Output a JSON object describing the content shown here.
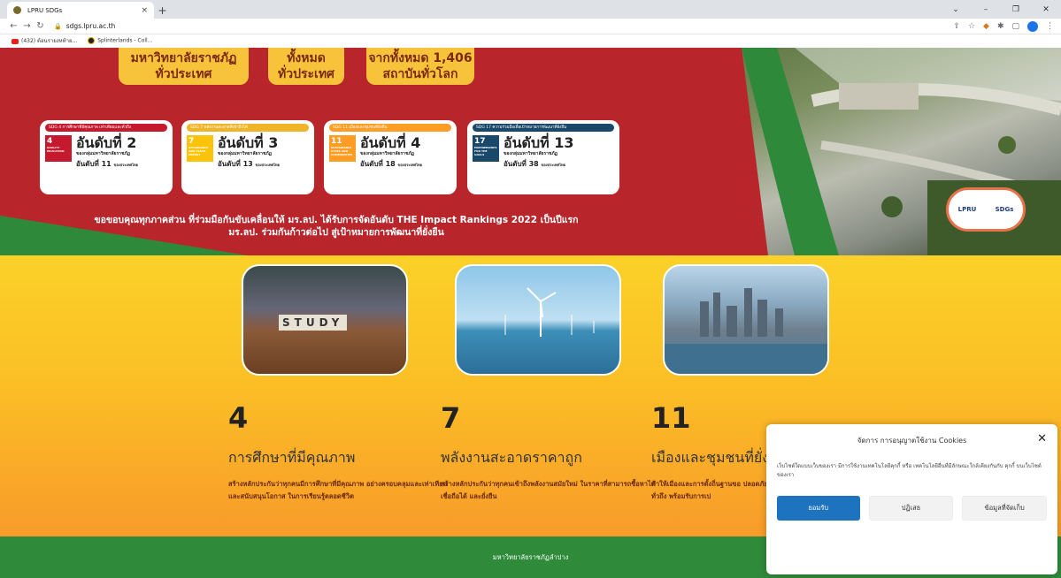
{
  "browser": {
    "tab_title": "LPRU SDGs",
    "tab_close": "×",
    "new_tab": "+",
    "url": "sdgs.lpru.ac.th",
    "bookmarks": [
      "(432) ต้อนรายงหท้าย...",
      "Splinterlands - Coll..."
    ]
  },
  "hero": {
    "top_boxes": [
      {
        "l1": "มหาวิทยาลัยราชภัฏ",
        "l2": "ทั่วประเทศ"
      },
      {
        "l1": "ทั้งหมด",
        "l2": "ทั่วประเทศ"
      },
      {
        "l1": "จากทั้งหมด 1,406",
        "l2": "สถาบันทั่วโลก"
      }
    ],
    "cards": [
      {
        "cap": "SDG 4 การศึกษาที่มีคุณภาพ เท่าเทียมและทั่วถึง",
        "sdg_no": "4",
        "sdg_text": "QUALITY EDUCATION",
        "rank": "อันดับที่ 2",
        "sub": "ของกลุ่มมหาวิทยาลัยราชภัฏ",
        "nat": "อันดับที่ 11",
        "nat_sub": "ของประเทศไทย",
        "color": "#c5192d"
      },
      {
        "cap": "SDG 7 พลังงานสะอาดที่เข้าถึงได้",
        "sdg_no": "7",
        "sdg_text": "AFFORDABLE AND CLEAN ENERGY",
        "rank": "อันดับที่ 3",
        "sub": "ของกลุ่มมหาวิทยาลัยราชภัฏ",
        "nat": "อันดับที่ 13",
        "nat_sub": "ของประเทศไทย",
        "color": "#fcc30b"
      },
      {
        "cap": "SDG 11 เมืองและชุมชนที่ยั่งยืน",
        "sdg_no": "11",
        "sdg_text": "SUSTAINABLE CITIES AND COMMUNITIES",
        "rank": "อันดับที่ 4",
        "sub": "ของกลุ่มมหาวิทยาลัยราชภัฏ",
        "nat": "อันดับที่ 18",
        "nat_sub": "ของประเทศไทย",
        "color": "#fd9d24"
      },
      {
        "cap": "SDG 17 ความร่วมมือเพื่อเป้าหมายการพัฒนาที่ยั่งยืน",
        "sdg_no": "17",
        "sdg_text": "PARTNERSHIPS FOR THE GOALS",
        "rank": "อันดับที่ 13",
        "sub": "ของกลุ่มมหาวิทยาลัยราชภัฏ",
        "nat": "อันดับที่ 38",
        "nat_sub": "ของประเทศไทย",
        "color": "#19486a"
      }
    ],
    "thanks_l1": "ขอขอบคุณทุกภาคส่วน ที่ร่วมมือกันขับเคลื่อนให้ มร.ลป. ได้รับการจัดอันดับ THE Impact Rankings 2022 เป็นปีแรก",
    "thanks_l2": "มร.ลป. ร่วมกันก้าวต่อไป สู่เป้าหมายการพัฒนาที่ยั่งยืน",
    "badge_left": "LPRU",
    "badge_right": "SDGs"
  },
  "pics": {
    "study_word": "STUDY"
  },
  "goals": [
    {
      "num": "4",
      "title": "การศึกษาที่มีคุณภาพ",
      "desc": "สร้างหลักประกันว่าทุกคนมีการศึกษาที่มีคุณภาพ อย่างครอบคลุมและเท่าเทียม และสนับสนุนโอกาส ในการเรียนรู้ตลอดชีวิต"
    },
    {
      "num": "7",
      "title": "พลังงานสะอาดราคาถูก",
      "desc": "สร้างหลักประกันว่าทุกคนเข้าถึงพลังงานสมัยใหม่ ในราคาที่สามารถซื้อหาได้ เชื่อถือได้ และยั่งยืน"
    },
    {
      "num": "11",
      "title": "เมืองและชุมชนที่ยั่งยืน",
      "desc": "ทำให้เมืองและการตั้งถิ่นฐานขอ ปลอดภัย ทั่วถึง พร้อมรับการเป"
    }
  ],
  "footer": "มหาวิทยาลัยราชภัฏลำปาง",
  "cookie": {
    "title": "จัดการ การอนุญาตใช้งาน Cookies",
    "close": "✕",
    "body": "เว็บไซต์ใดแบบเว็บของเรา มีการใช้งานเทคโนโลยีคุกกี้ หรือ เทคโนโลยีอื่นที่มีลักษณะใกล้เคียงกันกับ คุกกี้ บนเว็บไซต์ของเรา",
    "accept": "ยอมรับ",
    "deny": "ปฏิเสธ",
    "prefs": "ข้อมูลที่จัดเก็บ"
  }
}
